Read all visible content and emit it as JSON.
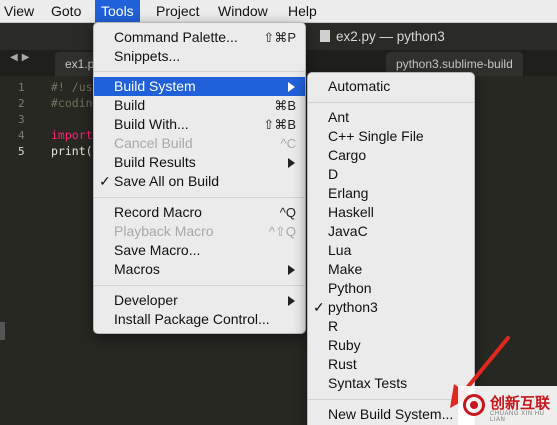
{
  "menubar": {
    "items": [
      "View",
      "Goto",
      "Tools",
      "Project",
      "Window",
      "Help"
    ]
  },
  "window": {
    "title": "ex2.py — python3"
  },
  "tabs": [
    "ex1.py",
    "python3.sublime-build"
  ],
  "editor": {
    "line_numbers": [
      "1",
      "2",
      "3",
      "4",
      "5"
    ],
    "lines": [
      "#! /us",
      "#codin",
      "",
      "import",
      "print("
    ]
  },
  "tools_menu": {
    "items": [
      {
        "label": "Command Palette...",
        "shortcut": "⇧⌘P"
      },
      {
        "label": "Snippets..."
      },
      {
        "label": "Build System",
        "submenu": true
      },
      {
        "label": "Build",
        "shortcut": "⌘B"
      },
      {
        "label": "Build With...",
        "shortcut": "⇧⌘B"
      },
      {
        "label": "Cancel Build",
        "shortcut": "^C"
      },
      {
        "label": "Build Results",
        "submenu": true
      },
      {
        "label": "Save All on Build",
        "checked": true
      },
      {
        "label": "Record Macro",
        "shortcut": "^Q"
      },
      {
        "label": "Playback Macro",
        "shortcut": "^⇧Q"
      },
      {
        "label": "Save Macro..."
      },
      {
        "label": "Macros",
        "submenu": true
      },
      {
        "label": "Developer",
        "submenu": true
      },
      {
        "label": "Install Package Control..."
      }
    ]
  },
  "build_system_menu": {
    "items": [
      "Automatic",
      "Ant",
      "C++ Single File",
      "Cargo",
      "D",
      "Erlang",
      "Haskell",
      "JavaC",
      "Lua",
      "Make",
      "Python",
      "python3",
      "R",
      "Ruby",
      "Rust",
      "Syntax Tests",
      "New Build System..."
    ],
    "checked": "python3"
  },
  "watermark": {
    "text": "创新互联",
    "subtext": "CHUANG XIN HU LIAN"
  },
  "colors": {
    "highlight": "#2060d8",
    "menu_bg": "#ebebeb",
    "editor_bg": "#272822",
    "annotation_red": "#e0281e"
  }
}
